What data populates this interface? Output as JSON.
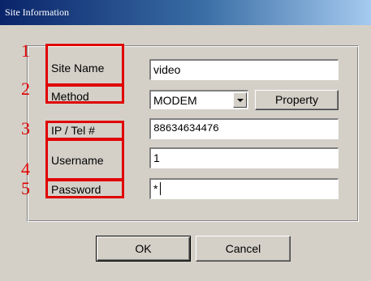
{
  "window": {
    "title": "Site Information"
  },
  "form": {
    "site_name_label": "Site Name",
    "method_label": "Method",
    "ip_label": "IP / Tel #",
    "username_label": "Username",
    "password_label": "Password",
    "site_name_value": "video",
    "method_value": "MODEM",
    "ip_value": "88634634476",
    "username_value": "1",
    "password_value": "*"
  },
  "buttons": {
    "property": "Property",
    "ok": "OK",
    "cancel": "Cancel"
  },
  "annotations": [
    "1",
    "2",
    "3",
    "4",
    "5"
  ],
  "colors": {
    "annotation_red": "#e00000",
    "dialog_bg": "#d4d0c8"
  }
}
